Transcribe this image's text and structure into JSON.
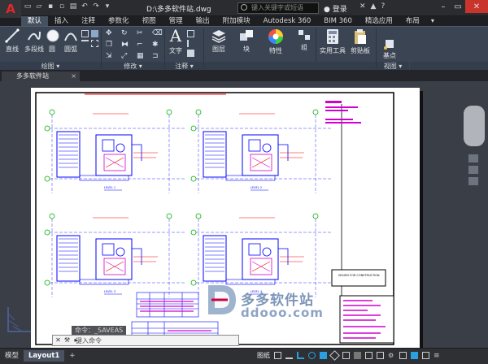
{
  "app": {
    "logo_letter": "A",
    "document_title": "D:\\多多软件站.dwg",
    "search_placeholder": "键入关键字或短语",
    "login_label": "登录"
  },
  "ribbon_tabs": [
    "默认",
    "插入",
    "注释",
    "参数化",
    "视图",
    "管理",
    "输出",
    "附加模块",
    "Autodesk 360",
    "BIM 360",
    "精选应用",
    "布局"
  ],
  "ribbon_tab_active": 0,
  "ribbon_tab_more": "▾",
  "ribbon": {
    "draw_buttons": [
      "直线",
      "多段线",
      "圆",
      "圆弧"
    ],
    "text_button": "文字",
    "layer_button": "图层",
    "block_button": "块",
    "properties_button": "特性",
    "group_button": "组",
    "utilities_button": "实用工具",
    "clipboard_button": "剪贴板",
    "basepoint_button": "基点",
    "panels": [
      "绘图",
      "修改",
      "注释",
      "视图"
    ]
  },
  "file_tab": {
    "label": "多多软件站",
    "close": "×"
  },
  "command": {
    "history": "命令：_SAVEAS",
    "placeholder": "键入命令"
  },
  "watermark": {
    "text": "多多软件站",
    "url": "ddooo.com"
  },
  "drawing_text": {
    "issued_for": "ISSUED FOR CONSTRUCTION",
    "level_labels": [
      "LEVEL 1",
      "LEVEL 2",
      "LEVEL 3",
      "LEVEL 4"
    ]
  },
  "status": {
    "tabs": [
      "模型",
      "Layout1"
    ],
    "active_tab": 1,
    "add": "+",
    "paper_label": "图纸"
  },
  "colors": {
    "accent": "#465160",
    "autocad_red": "#e3262c",
    "drawing_blue": "#0000ff",
    "grid_green": "#00b000",
    "annotation_red": "#ff0000",
    "magenta": "#d000d0"
  }
}
